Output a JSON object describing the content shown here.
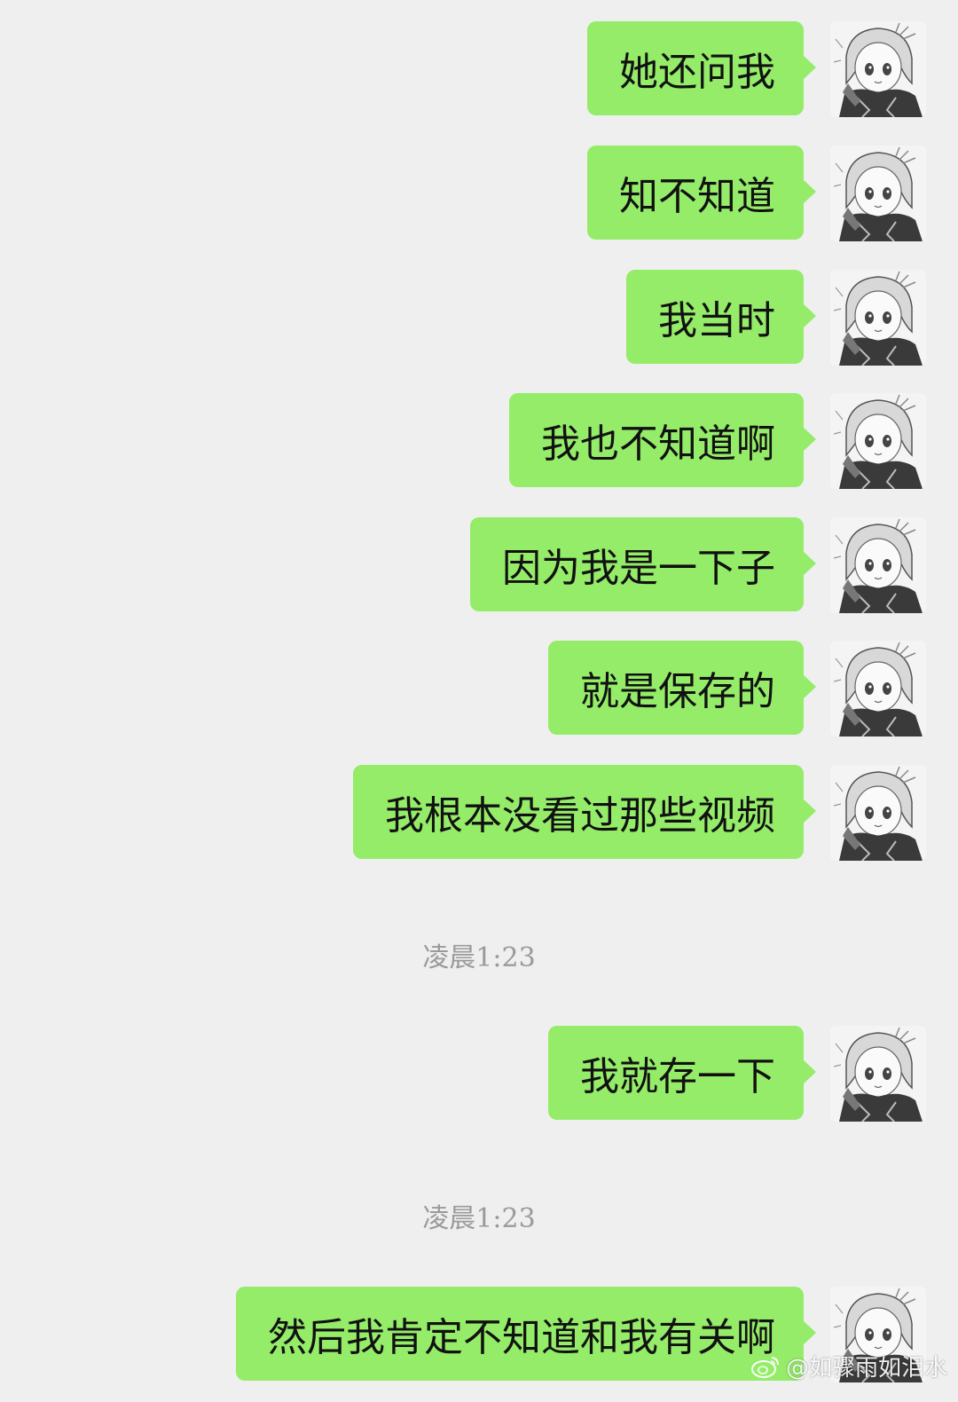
{
  "messages": [
    {
      "text": "她还问我"
    },
    {
      "text": "知不知道"
    },
    {
      "text": "我当时"
    },
    {
      "text": "我也不知道啊"
    },
    {
      "text": "因为我是一下子"
    },
    {
      "text": "就是保存的"
    },
    {
      "text": "我根本没看过那些视频"
    },
    {
      "text": "我就存一下"
    },
    {
      "text": "然后我肯定不知道和我有关啊"
    }
  ],
  "timestamps": [
    "凌晨1:23",
    "凌晨1:23"
  ],
  "watermark": {
    "text": "@如骤雨如泪水",
    "icon": "weibo-icon"
  },
  "colors": {
    "background": "#efefef",
    "sent_bubble": "#95ec69",
    "timestamp_text": "#9a9a9a"
  }
}
